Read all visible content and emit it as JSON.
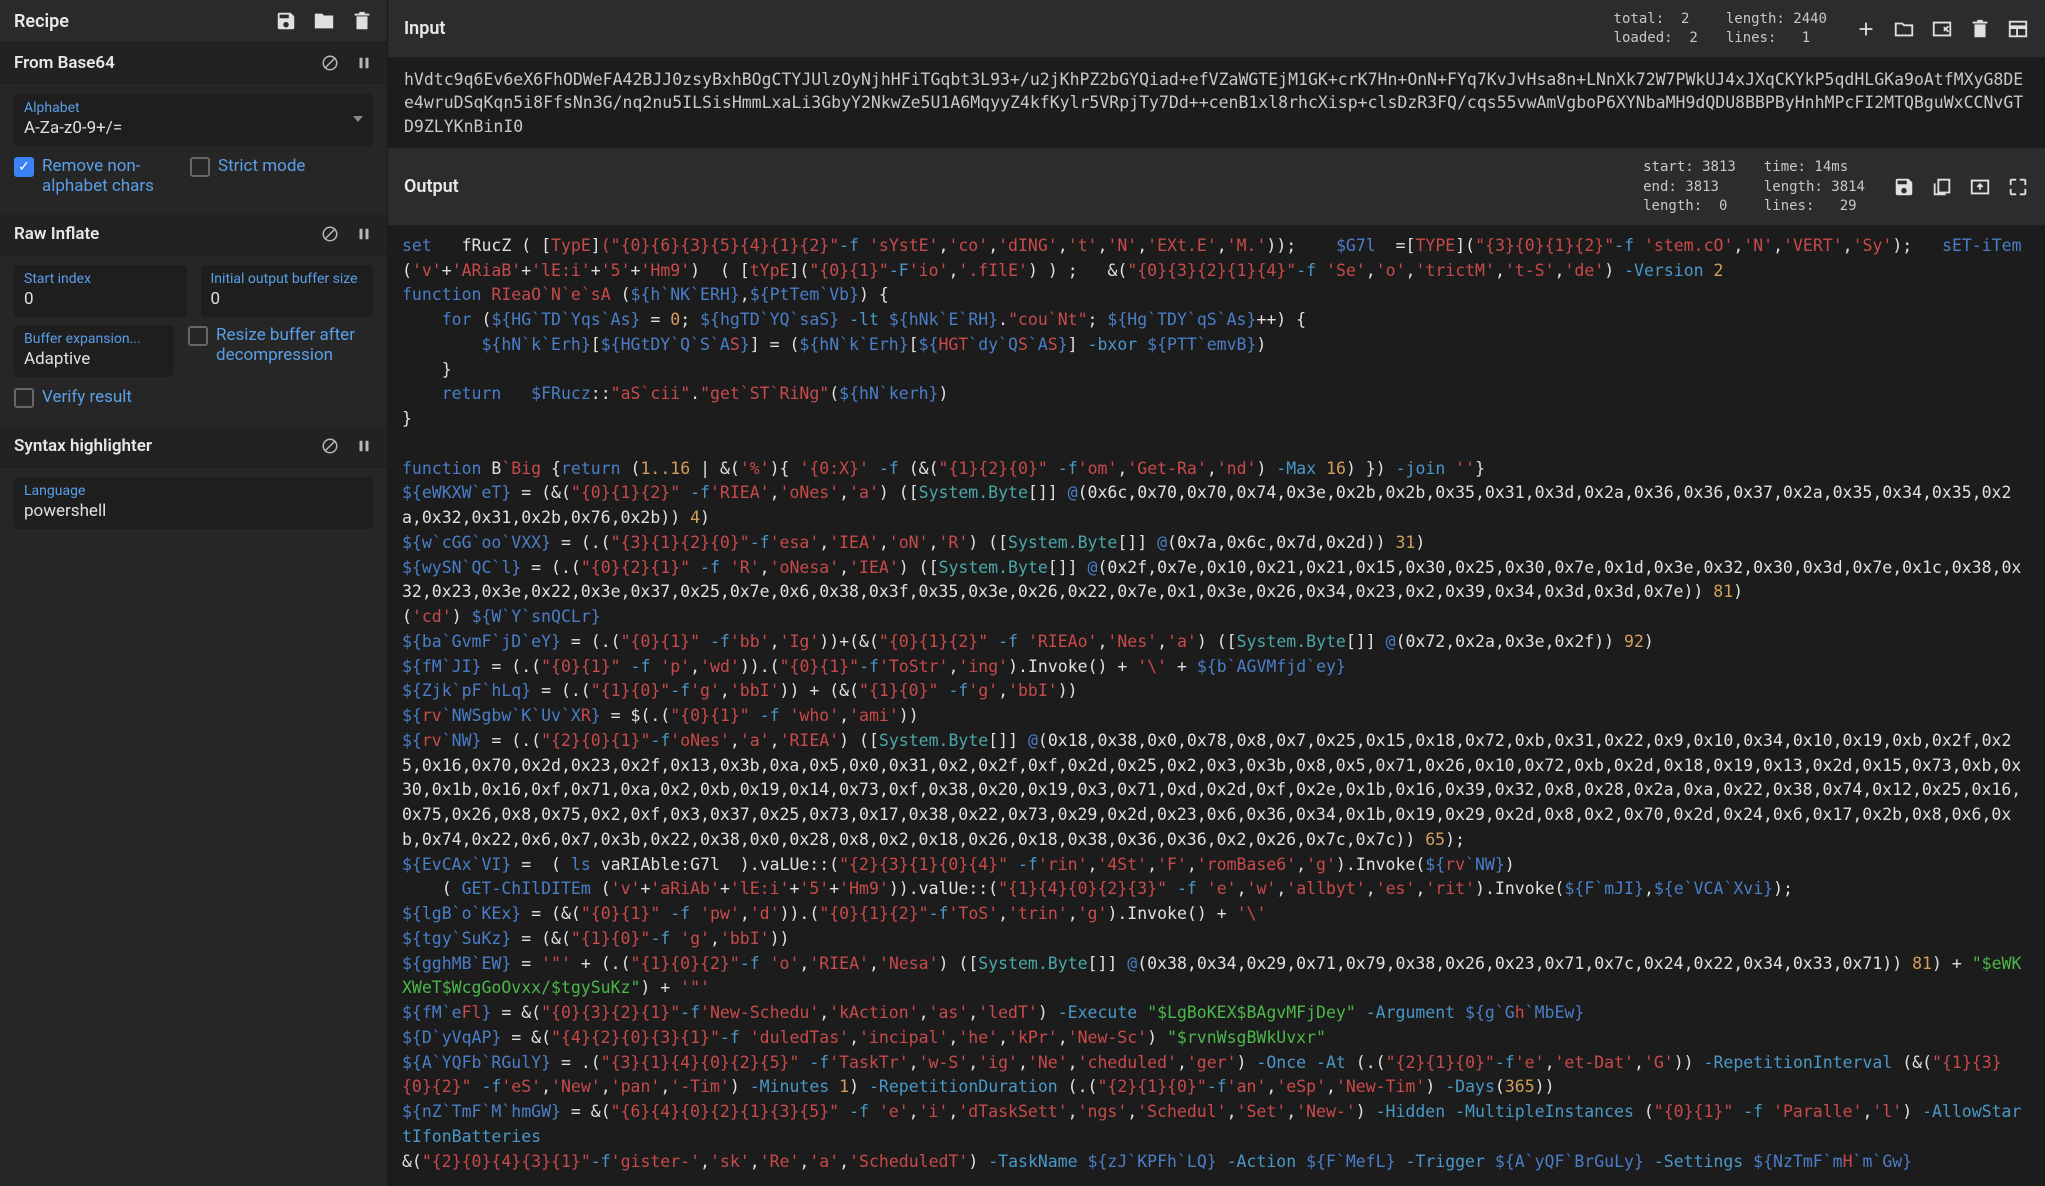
{
  "recipe": {
    "title": "Recipe",
    "ops": [
      {
        "name": "From Base64",
        "fields": [
          {
            "label": "Alphabet",
            "value": "A-Za-z0-9+/=",
            "type": "select"
          }
        ],
        "checks": [
          {
            "label": "Remove non-alphabet chars",
            "checked": true
          },
          {
            "label": "Strict mode",
            "checked": false
          }
        ]
      },
      {
        "name": "Raw Inflate",
        "fields": [
          {
            "label": "Start index",
            "value": "0"
          },
          {
            "label": "Initial output buffer size",
            "value": "0"
          },
          {
            "label": "Buffer expansion...",
            "value": "Adaptive"
          }
        ],
        "checks": [
          {
            "label": "Resize buffer after decompression",
            "checked": false
          },
          {
            "label": "Verify result",
            "checked": false
          }
        ]
      },
      {
        "name": "Syntax highlighter",
        "fields": [
          {
            "label": "Language",
            "value": "powershell"
          }
        ],
        "checks": []
      }
    ]
  },
  "input": {
    "title": "Input",
    "stats": {
      "total": "total:  2",
      "loaded": "loaded:  2",
      "length": "length: 2440",
      "lines": "lines:   1"
    },
    "text": "hVdtc9q6Ev6eX6FhODWeFA42BJJ0zsyBxhBOgCTYJUlzOyNjhHFiTGqbt3L93+/u2jKhPZ2bGYQiad+efVZaWGTEjM1GK+crK7Hn+OnN+FYq7KvJvHsa8n+LNnXk72W7PWkUJ4xJXqCKYkP5qdHLGKa9oAtfMXyG8DEe4wruDSqKqn5i8FfsNn3G/nq2nu5ILSisHmmLxaLi3GbyY2NkwZe5U1A6MqyyZ4kfKylr5VRpjTy7Dd++cenB1xl8rhcXisp+clsDzR3FQ/cqs55vwAmVgboP6XYNbaMH9dQDU8BBPByHnhMPcFI2MTQBguWxCCNvGTD9ZLYKnBinI0"
  },
  "output": {
    "title": "Output",
    "stats": {
      "start": "start: 3813",
      "end": "end: 3813",
      "length_l": "length:  0",
      "time": "time: 14ms",
      "length_r": "length: 3814",
      "lines": "lines:   29"
    }
  }
}
